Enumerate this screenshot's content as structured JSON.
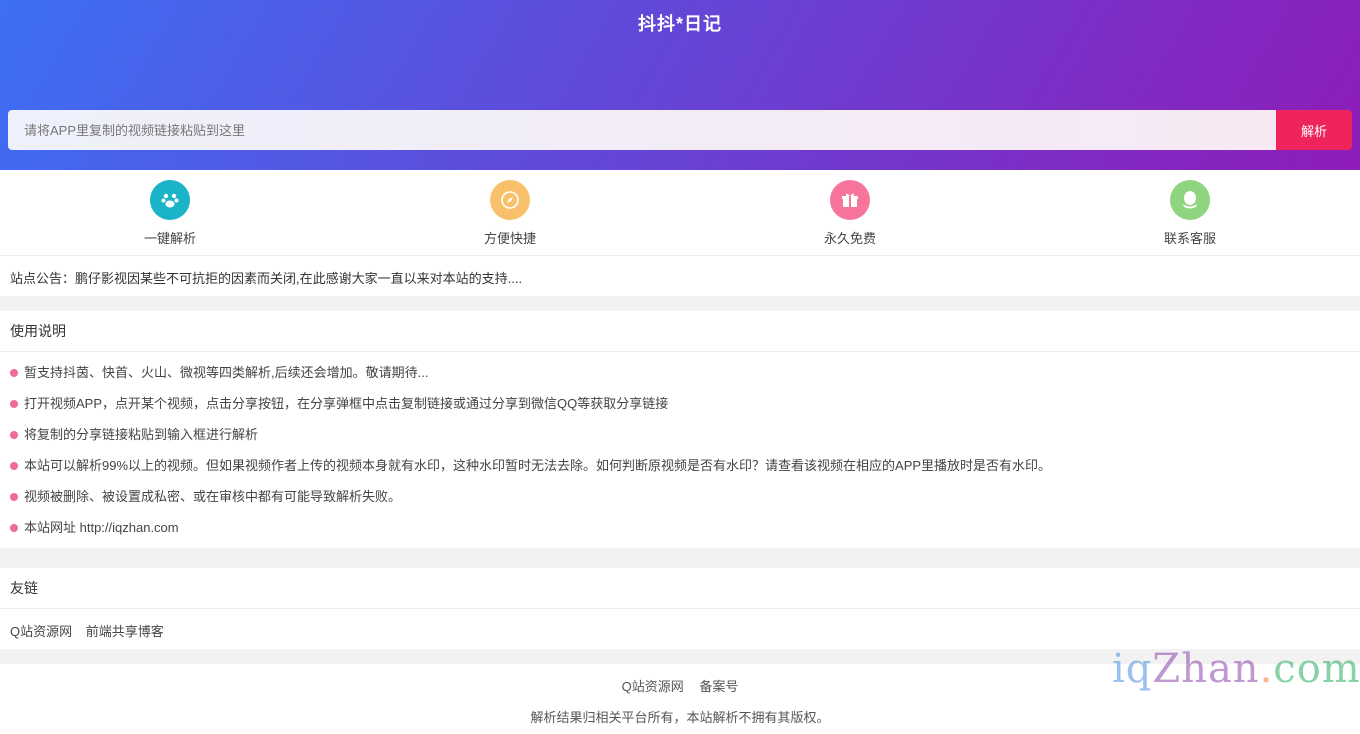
{
  "header": {
    "logo": "抖抖*日记",
    "search_placeholder": "请将APP里复制的视频链接粘贴到这里",
    "parse_button": "解析"
  },
  "features": [
    {
      "label": "一键解析",
      "icon": "paw-icon",
      "color": "#1ab3c8"
    },
    {
      "label": "方便快捷",
      "icon": "compass-icon",
      "color": "#f9c06b"
    },
    {
      "label": "永久免费",
      "icon": "gift-icon",
      "color": "#f7759a"
    },
    {
      "label": "联系客服",
      "icon": "qq-icon",
      "color": "#8fd47e"
    }
  ],
  "notice": "站点公告：鹏仔影视因某些不可抗拒的因素而关闭,在此感谢大家一直以来对本站的支持....",
  "usage": {
    "title": "使用说明",
    "items": [
      "暂支持抖茵、快首、火山、微视等四类解析,后续还会增加。敬请期待...",
      "打开视频APP，点开某个视频，点击分享按钮，在分享弹框中点击复制链接或通过分享到微信QQ等获取分享链接",
      "将复制的分享链接粘贴到输入框进行解析",
      "本站可以解析99%以上的视频。但如果视频作者上传的视频本身就有水印，这种水印暂时无法去除。如何判断原视频是否有水印？请查看该视频在相应的APP里播放时是否有水印。",
      "视频被删除、被设置成私密、或在审核中都有可能导致解析失败。",
      "本站网址 http://iqzhan.com"
    ],
    "bullet_color": "#f06a9a"
  },
  "links": {
    "title": "友链",
    "items": [
      "Q站资源网",
      "前端共享博客"
    ]
  },
  "footer": {
    "links": [
      "Q站资源网",
      "备案号"
    ],
    "copyright": "解析结果归相关平台所有，本站解析不拥有其版权。"
  },
  "watermark": {
    "parts": [
      "iq",
      "Zhan",
      ".",
      "com"
    ]
  }
}
